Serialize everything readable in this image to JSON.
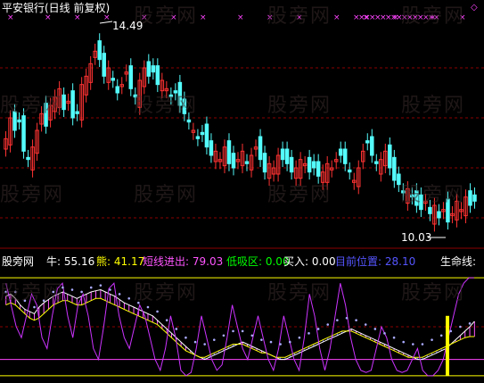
{
  "title": "平安银行(日线 前复权)",
  "watermark": "股旁网",
  "colors": {
    "up": "#ff3232",
    "down": "#54fcfc",
    "grid": "#8c0000",
    "marker": "#ff44ff",
    "title": "#ffffff"
  },
  "price_annotations": {
    "high_label": "14.49",
    "low_label": "10.03"
  },
  "indicator_bar": {
    "name": "股旁网",
    "items": [
      {
        "label": "牛: 55.16",
        "color": "#ffffff"
      },
      {
        "label": "熊: 41.17",
        "color": "#ffff00"
      },
      {
        "label": "短线进出: 79.03",
        "color": "#ff55ff"
      },
      {
        "label": "低吸区: 0.00",
        "color": "#00ff00"
      },
      {
        "label": "买入: 0.00",
        "color": "#ffffff"
      },
      {
        "label": "目前位置: 28.10",
        "color": "#5555ff"
      },
      {
        "label": "生命线:",
        "color": "#ffffff"
      }
    ]
  },
  "chart_data": {
    "type": "candlestick",
    "title": "平安银行(日线 前复权)",
    "high_mark": 14.49,
    "low_mark": 10.03,
    "close": [
      12.1,
      12.6,
      12.3,
      12.5,
      11.8,
      11.6,
      11.9,
      12.3,
      12.7,
      12.4,
      12.9,
      13.1,
      13.3,
      12.8,
      13.0,
      12.6,
      12.7,
      13.4,
      13.6,
      13.9,
      14.2,
      14.0,
      13.6,
      13.8,
      13.5,
      13.2,
      13.4,
      13.7,
      13.3,
      13.1,
      13.5,
      13.8,
      13.6,
      13.7,
      13.4,
      13.5,
      13.3,
      13.1,
      13.2,
      12.9,
      12.7,
      12.5,
      12.3,
      12.1,
      12.2,
      11.9,
      11.7,
      11.8,
      11.6,
      11.9,
      11.5,
      11.4,
      11.6,
      11.8,
      11.5,
      11.7,
      11.9,
      11.6,
      11.3,
      11.5,
      11.4,
      11.7,
      11.6,
      11.5,
      11.3,
      11.4,
      11.6,
      11.5,
      11.3,
      11.4,
      11.2,
      11.3,
      11.5,
      11.4,
      11.6,
      11.7,
      11.5,
      11.3,
      11.1,
      11.4,
      11.8,
      12.0,
      11.7,
      11.5,
      11.6,
      11.8,
      11.4,
      11.1,
      11.0,
      10.8,
      10.9,
      10.7,
      10.5,
      10.4,
      10.6,
      10.3,
      10.5,
      10.2,
      10.4,
      10.1,
      10.3,
      10.6,
      10.4,
      10.7,
      10.5,
      10.6
    ],
    "ylim": [
      9.6,
      15.0
    ],
    "markers_row": true,
    "indicator": {
      "ylim": [
        0,
        100
      ],
      "bull": 55.16,
      "bear": 41.17,
      "short_in_out": 79.03,
      "low_absorb_zone": 0.0,
      "buy": 0.0,
      "current_position": 28.1,
      "life_line": "",
      "bull_series": [
        78,
        80,
        76,
        70,
        66,
        64,
        62,
        68,
        72,
        75,
        78,
        80,
        82,
        80,
        78,
        76,
        78,
        80,
        82,
        83,
        84,
        82,
        80,
        78,
        75,
        72,
        70,
        68,
        66,
        64,
        62,
        60,
        56,
        52,
        48,
        44,
        40,
        36,
        32,
        28,
        24,
        22,
        20,
        22,
        24,
        26,
        28,
        30,
        32,
        34,
        36,
        34,
        32,
        30,
        28,
        26,
        24,
        22,
        20,
        20,
        22,
        24,
        26,
        28,
        30,
        32,
        34,
        36,
        38,
        40,
        42,
        44,
        46,
        48,
        46,
        44,
        42,
        40,
        38,
        36,
        34,
        32,
        30,
        28,
        26,
        24,
        22,
        20,
        20,
        22,
        24,
        26,
        28,
        30,
        34,
        38,
        42,
        46,
        50,
        55
      ],
      "bear_series": [
        70,
        72,
        70,
        66,
        62,
        58,
        56,
        58,
        62,
        66,
        70,
        72,
        74,
        74,
        72,
        70,
        70,
        72,
        74,
        76,
        76,
        74,
        72,
        70,
        68,
        66,
        64,
        62,
        60,
        58,
        56,
        54,
        52,
        48,
        44,
        40,
        36,
        32,
        28,
        26,
        24,
        22,
        22,
        24,
        26,
        28,
        30,
        32,
        34,
        34,
        34,
        32,
        30,
        28,
        26,
        26,
        24,
        22,
        22,
        22,
        24,
        26,
        28,
        30,
        32,
        34,
        36,
        38,
        40,
        42,
        44,
        46,
        46,
        46,
        44,
        42,
        40,
        38,
        36,
        34,
        32,
        30,
        28,
        26,
        24,
        22,
        22,
        22,
        22,
        24,
        26,
        28,
        30,
        32,
        34,
        36,
        38,
        40,
        41,
        41
      ],
      "purple_series": [
        90,
        70,
        50,
        40,
        60,
        80,
        70,
        40,
        30,
        60,
        85,
        90,
        60,
        40,
        70,
        80,
        60,
        30,
        20,
        50,
        85,
        90,
        60,
        40,
        30,
        50,
        70,
        60,
        40,
        20,
        10,
        30,
        60,
        40,
        10,
        5,
        8,
        30,
        60,
        40,
        20,
        10,
        15,
        40,
        70,
        50,
        30,
        20,
        40,
        60,
        40,
        20,
        10,
        30,
        60,
        40,
        20,
        10,
        40,
        80,
        60,
        30,
        10,
        30,
        60,
        90,
        70,
        40,
        20,
        10,
        8,
        10,
        30,
        50,
        40,
        20,
        10,
        8,
        10,
        20,
        30,
        10,
        5,
        5,
        10,
        20,
        40,
        60,
        80,
        90,
        95,
        95
      ]
    }
  }
}
